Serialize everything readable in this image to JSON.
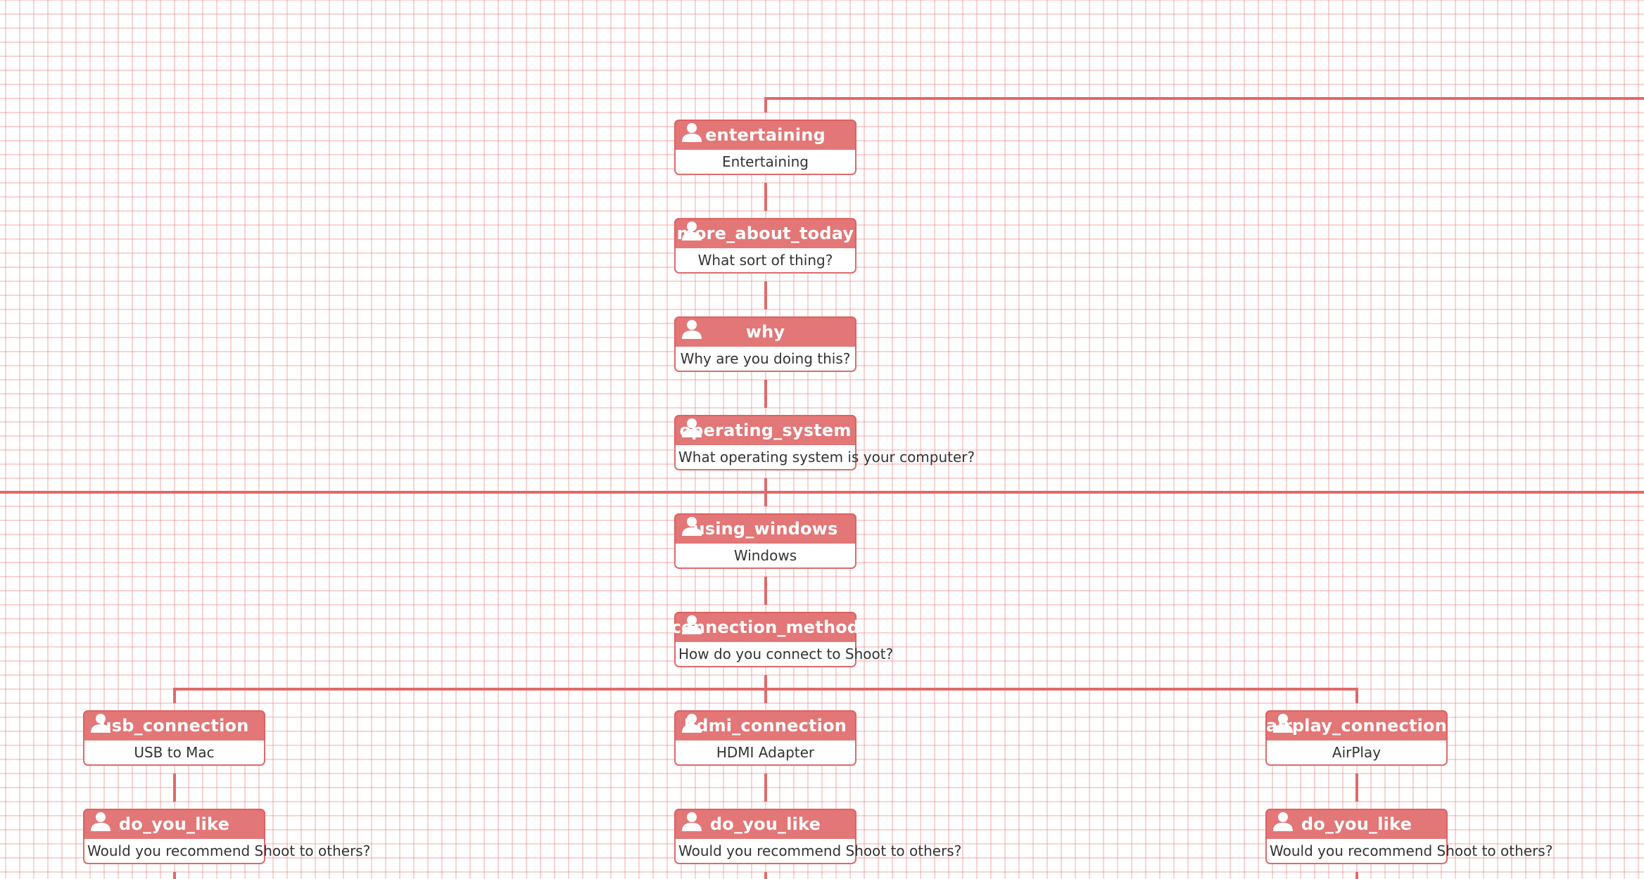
{
  "diagram": {
    "type": "flowchart",
    "colors": {
      "accent": "#e06a6a",
      "grid": "#f5c6c6",
      "header_text": "#ffffff",
      "body_text": "#333333"
    },
    "nodes": [
      {
        "id": "entertaining",
        "title": "entertaining",
        "text": "Entertaining",
        "icon": "user-icon"
      },
      {
        "id": "more_about_today",
        "title": "more_about_today",
        "text": "What sort of thing?",
        "icon": "user-icon"
      },
      {
        "id": "why",
        "title": "why",
        "text": "Why are you doing this?",
        "icon": "user-icon"
      },
      {
        "id": "operating_system",
        "title": "operating_system",
        "text": "What operating system is your computer?",
        "icon": "user-icon"
      },
      {
        "id": "using_windows",
        "title": "using_windows",
        "text": "Windows",
        "icon": "user-icon"
      },
      {
        "id": "connection_method",
        "title": "connection_method",
        "text": "How do you connect to Shoot?",
        "icon": "user-icon"
      },
      {
        "id": "usb_connection",
        "title": "usb_connection",
        "text": "USB to Mac",
        "icon": "user-icon"
      },
      {
        "id": "hdmi_connection",
        "title": "hdmi_connection",
        "text": "HDMI Adapter",
        "icon": "user-icon"
      },
      {
        "id": "airplay_connection",
        "title": "airplay_connection",
        "text": "AirPlay",
        "icon": "user-icon"
      },
      {
        "id": "do_you_like_usb",
        "title": "do_you_like",
        "text": "Would you recommend Shoot to others?",
        "icon": "user-icon"
      },
      {
        "id": "do_you_like_hdmi",
        "title": "do_you_like",
        "text": "Would you recommend Shoot to others?",
        "icon": "user-icon"
      },
      {
        "id": "do_you_like_airplay",
        "title": "do_you_like",
        "text": "Would you recommend Shoot to others?",
        "icon": "user-icon"
      }
    ],
    "edges": [
      {
        "from": "entertaining",
        "to": "more_about_today"
      },
      {
        "from": "more_about_today",
        "to": "why"
      },
      {
        "from": "why",
        "to": "operating_system"
      },
      {
        "from": "operating_system",
        "to": "using_windows"
      },
      {
        "from": "using_windows",
        "to": "connection_method"
      },
      {
        "from": "connection_method",
        "to": "usb_connection"
      },
      {
        "from": "connection_method",
        "to": "hdmi_connection"
      },
      {
        "from": "connection_method",
        "to": "airplay_connection"
      },
      {
        "from": "usb_connection",
        "to": "do_you_like_usb"
      },
      {
        "from": "hdmi_connection",
        "to": "do_you_like_hdmi"
      },
      {
        "from": "airplay_connection",
        "to": "do_you_like_airplay"
      }
    ]
  }
}
